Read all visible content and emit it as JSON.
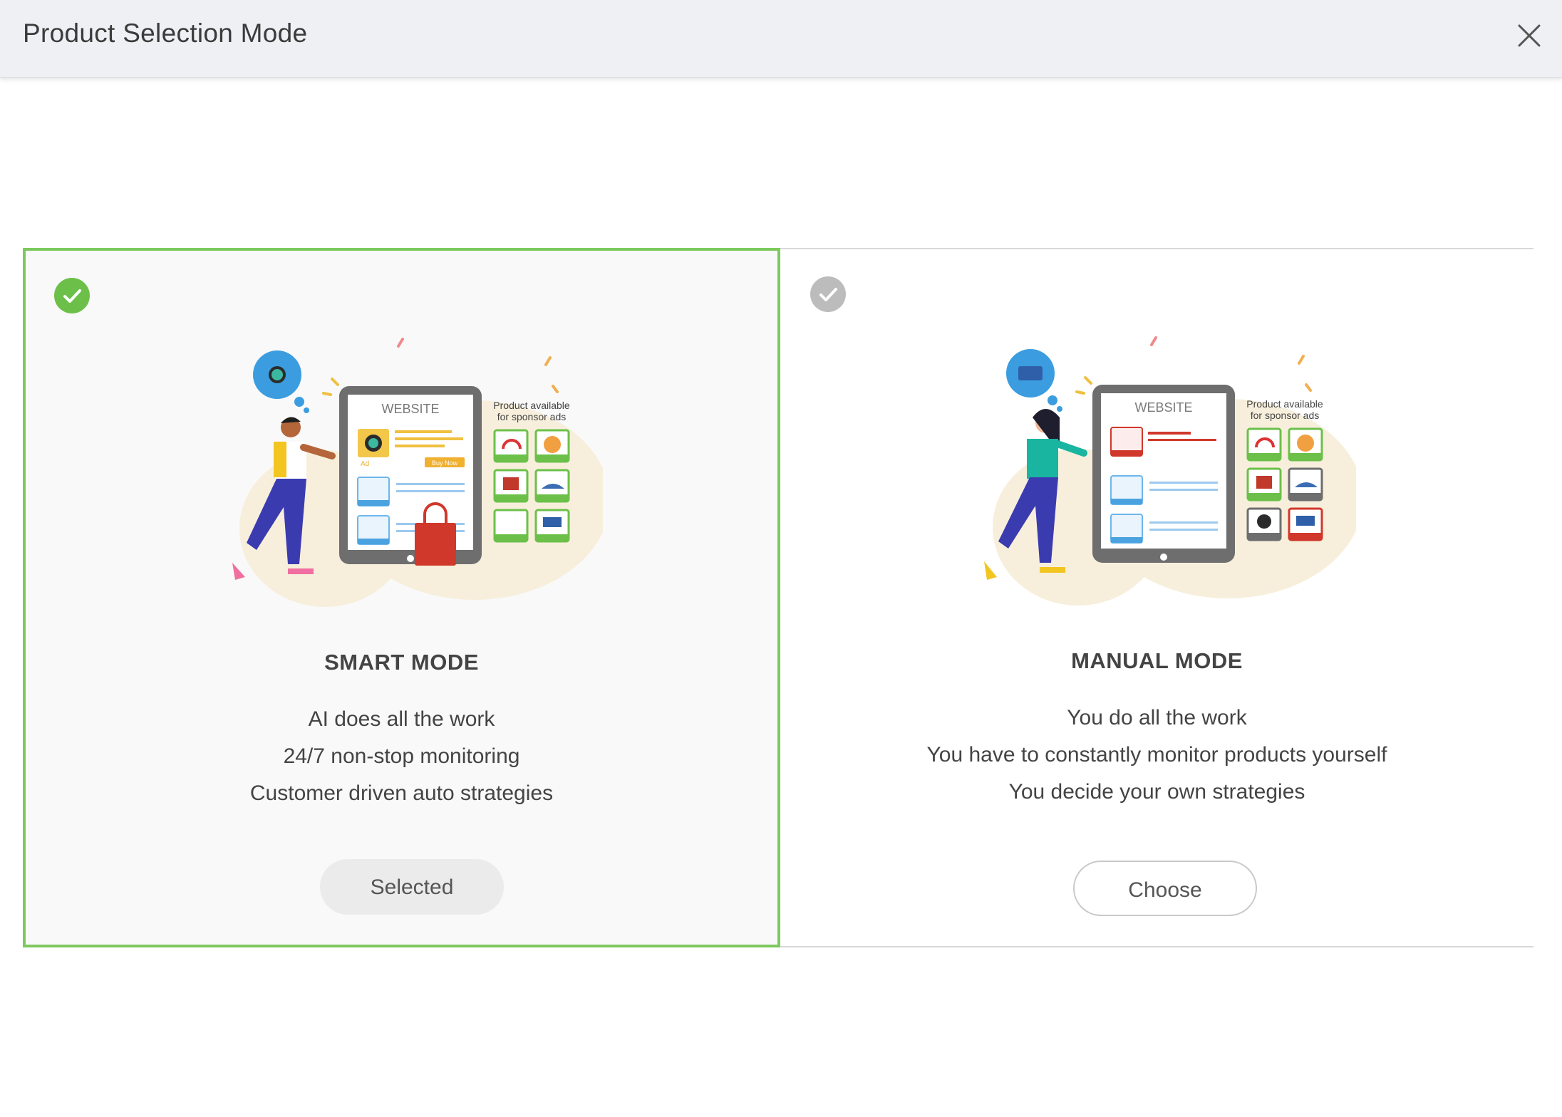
{
  "dialog": {
    "title": "Product Selection Mode",
    "close_icon": "close-icon"
  },
  "colors": {
    "selected_border": "#7dc95e",
    "selected_check": "#6cc04a",
    "unselected_check": "#bcbcbc"
  },
  "modes": [
    {
      "title": "SMART MODE",
      "selected": true,
      "features": [
        "AI does all the work",
        "24/7 non-stop monitoring",
        "Customer driven auto strategies"
      ],
      "button_label": "Selected"
    },
    {
      "title": "MANUAL MODE",
      "selected": false,
      "features": [
        "You do all the work",
        "You have to constantly monitor products yourself",
        "You decide your own strategies"
      ],
      "button_label": "Choose"
    }
  ],
  "illustration": {
    "screen_label": "WEBSITE",
    "sidebar_label_line1": "Product available",
    "sidebar_label_line2": "for sponsor ads",
    "ad_label": "Ad",
    "buy_label": "Buy Now"
  }
}
